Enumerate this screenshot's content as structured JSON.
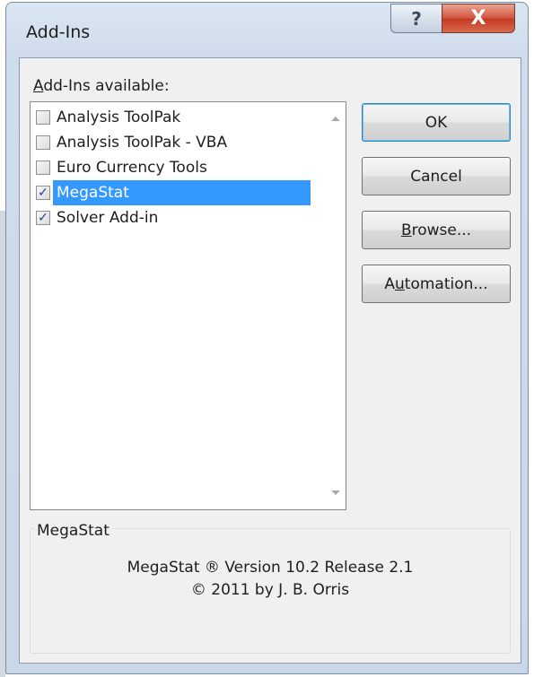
{
  "window": {
    "title": "Add-Ins",
    "help_glyph": "?",
    "close_glyph": "X"
  },
  "addins": {
    "label": "Add-Ins available:",
    "label_accesskey": "A",
    "label_rest": "dd-Ins available:",
    "items": [
      {
        "label": "Analysis ToolPak",
        "checked": false,
        "selected": false
      },
      {
        "label": "Analysis ToolPak - VBA",
        "checked": false,
        "selected": false
      },
      {
        "label": "Euro Currency Tools",
        "checked": false,
        "selected": false
      },
      {
        "label": "MegaStat",
        "checked": true,
        "selected": true
      },
      {
        "label": "Solver Add-in",
        "checked": true,
        "selected": false
      }
    ],
    "check_glyph": "✓"
  },
  "buttons": {
    "ok": "OK",
    "cancel": "Cancel",
    "browse": "Browse...",
    "browse_pre": "",
    "browse_key": "B",
    "browse_post": "rowse...",
    "automation": "Automation...",
    "automation_pre": "A",
    "automation_key": "u",
    "automation_post": "tomation..."
  },
  "details": {
    "group_title": "MegaStat",
    "line1": "MegaStat ® Version 10.2 Release 2.1",
    "line2": "© 2011 by J. B. Orris"
  },
  "colors": {
    "selection": "#3399ff",
    "close_button": "#c53a22"
  }
}
